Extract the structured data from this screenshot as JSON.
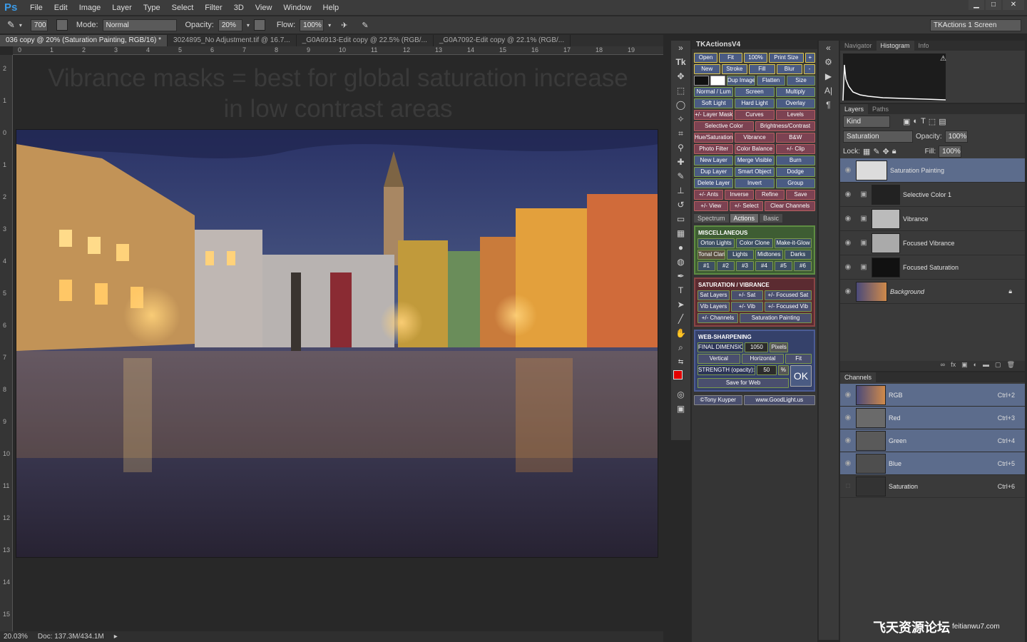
{
  "app": {
    "logo": "Ps"
  },
  "menu": [
    "File",
    "Edit",
    "Image",
    "Layer",
    "Type",
    "Select",
    "Filter",
    "3D",
    "View",
    "Window",
    "Help"
  ],
  "options": {
    "brush_size": "700",
    "mode_label": "Mode:",
    "mode_value": "Normal",
    "opacity_label": "Opacity:",
    "opacity_value": "20%",
    "flow_label": "Flow:",
    "flow_value": "100%",
    "workspace": "TKActions 1 Screen"
  },
  "doc_tabs": [
    "036 copy @ 20% (Saturation Painting, RGB/16) *",
    "3024895_No Adjustment.tif @ 16.7...",
    "_G0A6913-Edit copy @ 22.5% (RGB/...",
    "_G0A7092-Edit copy @ 22.1% (RGB/..."
  ],
  "ruler_top": [
    "0",
    "1",
    "2",
    "3",
    "4",
    "5",
    "6",
    "7",
    "8",
    "9",
    "10",
    "11",
    "12",
    "13",
    "14",
    "15",
    "16",
    "17",
    "18",
    "19"
  ],
  "ruler_left": [
    "2",
    "1",
    "0",
    "1",
    "2",
    "3",
    "4",
    "5",
    "6",
    "7",
    "8",
    "9",
    "10",
    "11",
    "12",
    "13",
    "14",
    "15"
  ],
  "overlay_text": [
    "Vibrance masks = best for global saturation increase",
    "in low contrast areas"
  ],
  "status": {
    "zoom": "20.03%",
    "doc": "Doc: 137.3M/434.1M"
  },
  "tk": {
    "title": "TKActionsV4",
    "rows": [
      [
        "Open",
        "Fit",
        "100%",
        "Print Size",
        "+"
      ],
      [
        "New",
        "Stroke",
        "Fill",
        "Blur",
        "-"
      ],
      [
        "Dup Image",
        "Flatten",
        "Size"
      ],
      [
        "Normal / Lum",
        "Screen",
        "Multiply"
      ],
      [
        "Soft Light",
        "Hard Light",
        "Overlay"
      ],
      [
        "+/- Layer Mask",
        "Curves",
        "Levels"
      ],
      [
        "Selective Color",
        "Brightness/Contrast"
      ],
      [
        "Hue/Saturation",
        "Vibrance",
        "B&W"
      ],
      [
        "Photo Filter",
        "Color Balance",
        "+/- Clip"
      ],
      [
        "New Layer",
        "Merge Visible",
        "Burn"
      ],
      [
        "Dup Layer",
        "Smart Object",
        "Dodge"
      ],
      [
        "Delete Layer",
        "Invert",
        "Group"
      ],
      [
        "+/- Ants",
        "Inverse",
        "Refine",
        "Save"
      ],
      [
        "+/- View",
        "+/- Select",
        "Clear Channels"
      ]
    ],
    "tabs": [
      "Spectrum",
      "Actions",
      "Basic"
    ],
    "misc_title": "MISCELLANEOUS",
    "misc_rows": [
      [
        "Orton Lights",
        "Color Clone",
        "Make-it-Glow"
      ],
      [
        "Tonal Clarity",
        "Lights",
        "Midtones",
        "Darks"
      ],
      [
        "#1",
        "#2",
        "#3",
        "#4",
        "#5",
        "#6"
      ]
    ],
    "sat_title": "SATURATION / VIBRANCE",
    "sat_rows": [
      [
        "Sat Layers",
        "+/- Sat",
        "+/- Focused Sat"
      ],
      [
        "Vib Layers",
        "+/- Vib",
        "+/- Focused Vib"
      ],
      [
        "+/- Channels",
        "Saturation Painting"
      ]
    ],
    "web_title": "WEB-SHARPENING",
    "web": {
      "final_label": "FINAL DIMENSION:",
      "final_value": "1050",
      "pixels": "Pixels",
      "vertical": "Vertical",
      "horizontal": "Horizontal",
      "fit": "Fit",
      "strength_label": "STRENGTH (opacity):",
      "strength_value": "50",
      "pct": "%",
      "ok": "OK",
      "save": "Save for Web"
    },
    "footer": [
      "©Tony Kuyper",
      "www.GoodLight.us"
    ]
  },
  "nav": {
    "tabs": [
      "Navigator",
      "Histogram",
      "Info"
    ]
  },
  "layers": {
    "tabs": [
      "Layers",
      "Paths"
    ],
    "kind": "Kind",
    "blend": "Saturation",
    "opacity_label": "Opacity:",
    "opacity_value": "100%",
    "lock_label": "Lock:",
    "fill_label": "Fill:",
    "fill_value": "100%",
    "items": [
      "Saturation Painting",
      "Selective Color 1",
      "Vibrance",
      "Focused Vibrance",
      "Focused Saturation",
      "Background"
    ]
  },
  "channels": {
    "title": "Channels",
    "items": [
      {
        "name": "RGB",
        "sc": "Ctrl+2"
      },
      {
        "name": "Red",
        "sc": "Ctrl+3"
      },
      {
        "name": "Green",
        "sc": "Ctrl+4"
      },
      {
        "name": "Blue",
        "sc": "Ctrl+5"
      },
      {
        "name": "Saturation",
        "sc": "Ctrl+6"
      }
    ]
  },
  "watermark": {
    "cn": "飞天资源论坛",
    "url": "feitianwu7.com"
  }
}
